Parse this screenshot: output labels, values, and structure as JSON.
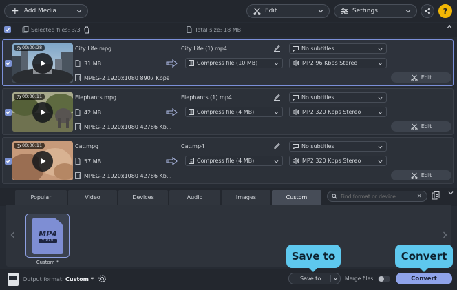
{
  "toolbar": {
    "add_media": "Add Media",
    "edit": "Edit",
    "settings": "Settings"
  },
  "files_bar": {
    "selected_files": "Selected files: 3/3",
    "total_size": "Total size: 18 MB"
  },
  "files": [
    {
      "duration": "00:00:28",
      "input_name": "City Life.mpg",
      "size": "31 MB",
      "codec": "MPEG-2 1920x1080 8907 Kbps",
      "output_name": "City Life (1).mp4",
      "compress": "Compress file (10 MB)",
      "subtitles": "No subtitles",
      "audio": "MP2 96 Kbps Stereo",
      "edit": "Edit"
    },
    {
      "duration": "00:00:11",
      "input_name": "Elephants.mpg",
      "size": "42 MB",
      "codec": "MPEG-2 1920x1080 42786 Kb...",
      "output_name": "Elephants (1).mp4",
      "compress": "Compress file (4 MB)",
      "subtitles": "No subtitles",
      "audio": "MP2 320 Kbps Stereo",
      "edit": "Edit"
    },
    {
      "duration": "00:00:11",
      "input_name": "Cat.mpg",
      "size": "57 MB",
      "codec": "MPEG-2 1920x1080 42786 Kb...",
      "output_name": "Cat.mp4",
      "compress": "Compress file (4 MB)",
      "subtitles": "No subtitles",
      "audio": "MP2 320 Kbps Stereo",
      "edit": "Edit"
    }
  ],
  "tabs": [
    "Popular",
    "Video",
    "Devices",
    "Audio",
    "Images",
    "Custom"
  ],
  "active_tab": "Custom",
  "search": {
    "placeholder": "Find format or device..."
  },
  "format_tile": {
    "badge": "MP4",
    "sub": "VIDEO",
    "label": "Custom *"
  },
  "bottom": {
    "output_format_label": "Output format:",
    "output_format_value": "Custom *",
    "save_to": "Save to...",
    "merge_files": "Merge files:",
    "convert": "Convert"
  },
  "callouts": {
    "save_to": "Save to",
    "convert": "Convert"
  },
  "colors": {
    "accent": "#7b92d4",
    "callout": "#5ec8ee",
    "help": "#f2b705"
  }
}
